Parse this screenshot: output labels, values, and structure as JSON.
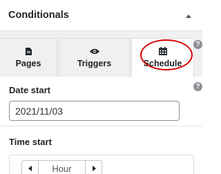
{
  "panel": {
    "title": "Conditionals"
  },
  "tabs": [
    {
      "label": "Pages",
      "icon": "page-icon"
    },
    {
      "label": "Triggers",
      "icon": "eye-icon"
    },
    {
      "label": "Schedule",
      "icon": "calendar-icon",
      "active": true
    }
  ],
  "date_start": {
    "label": "Date start",
    "value": "2021/11/03"
  },
  "time_start": {
    "label": "Time start",
    "unit": "Hour"
  },
  "help_symbol": "?",
  "colors": {
    "highlight_circle": "#d40000",
    "tab_bg": "#f0f0f1",
    "active_tab_bg": "#ffffff"
  }
}
